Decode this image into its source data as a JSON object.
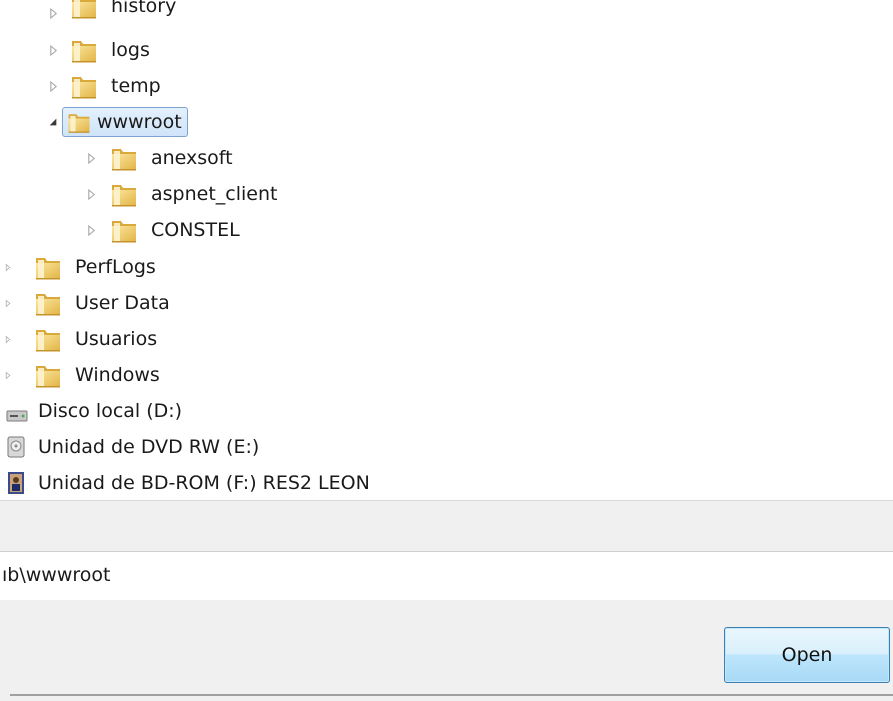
{
  "tree": {
    "items": [
      {
        "label": "history"
      },
      {
        "label": "logs"
      },
      {
        "label": "temp"
      },
      {
        "label": "wwwroot"
      },
      {
        "label": "anexsoft"
      },
      {
        "label": "aspnet_client"
      },
      {
        "label": "CONSTEL"
      },
      {
        "label": "PerfLogs"
      },
      {
        "label": "User Data"
      },
      {
        "label": "Usuarios"
      },
      {
        "label": "Windows"
      },
      {
        "label": "Disco local (D:)"
      },
      {
        "label": "Unidad de DVD RW (E:)"
      },
      {
        "label": "Unidad de BD-ROM (F:) RES2 LEON"
      }
    ]
  },
  "path_field": {
    "value": "ıb\\wwwroot"
  },
  "buttons": {
    "open_label": "Open"
  },
  "colors": {
    "selection_bg": "#cfe4fa",
    "selection_border": "#7da2ce",
    "folder_yellow": "#f3cf6d",
    "button_border": "#3c7fb1",
    "panel_gray": "#f0f0f0"
  }
}
